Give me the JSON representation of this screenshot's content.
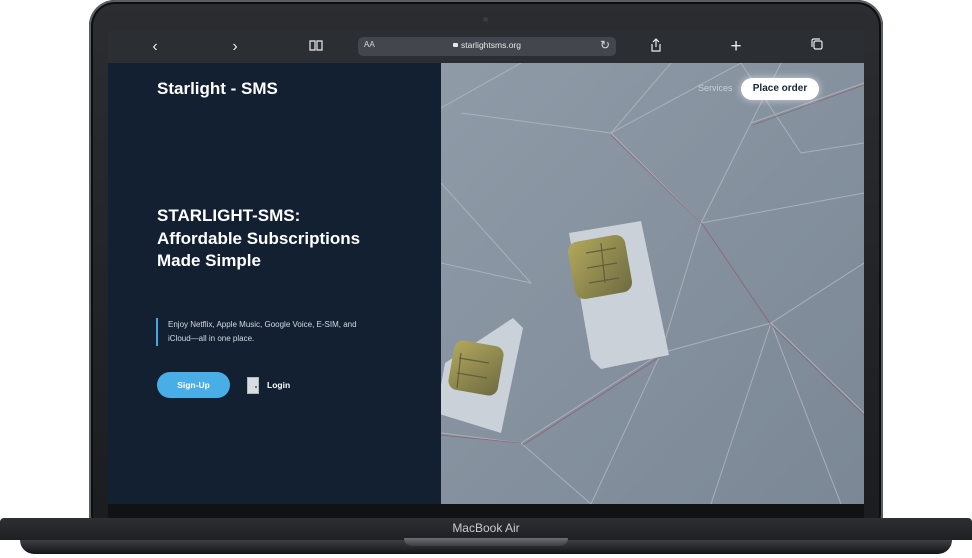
{
  "device": {
    "model_label": "MacBook Air"
  },
  "browser": {
    "reader_label": "AA",
    "url": "starlightsms.org"
  },
  "page": {
    "brand": "Starlight - SMS",
    "nav": {
      "services": "Services",
      "place_order": "Place order"
    },
    "hero": {
      "title": "STARLIGHT-SMS: Affordable Subscriptions Made Simple",
      "description": "Enjoy Netflix, Apple Music, Google Voice, E-SIM, and iCloud—all in one place.",
      "signup": "Sign-Up",
      "login": "Login"
    }
  },
  "icons": {
    "back": "chevron-left-icon",
    "forward": "chevron-right-icon",
    "bookmarks": "book-icon",
    "lock": "lock-icon",
    "reload": "reload-icon",
    "share": "share-icon",
    "new_tab": "plus-icon",
    "tabs": "tabs-icon",
    "login": "door-icon"
  },
  "colors": {
    "accent": "#4aaee6",
    "panel": "#122032"
  }
}
